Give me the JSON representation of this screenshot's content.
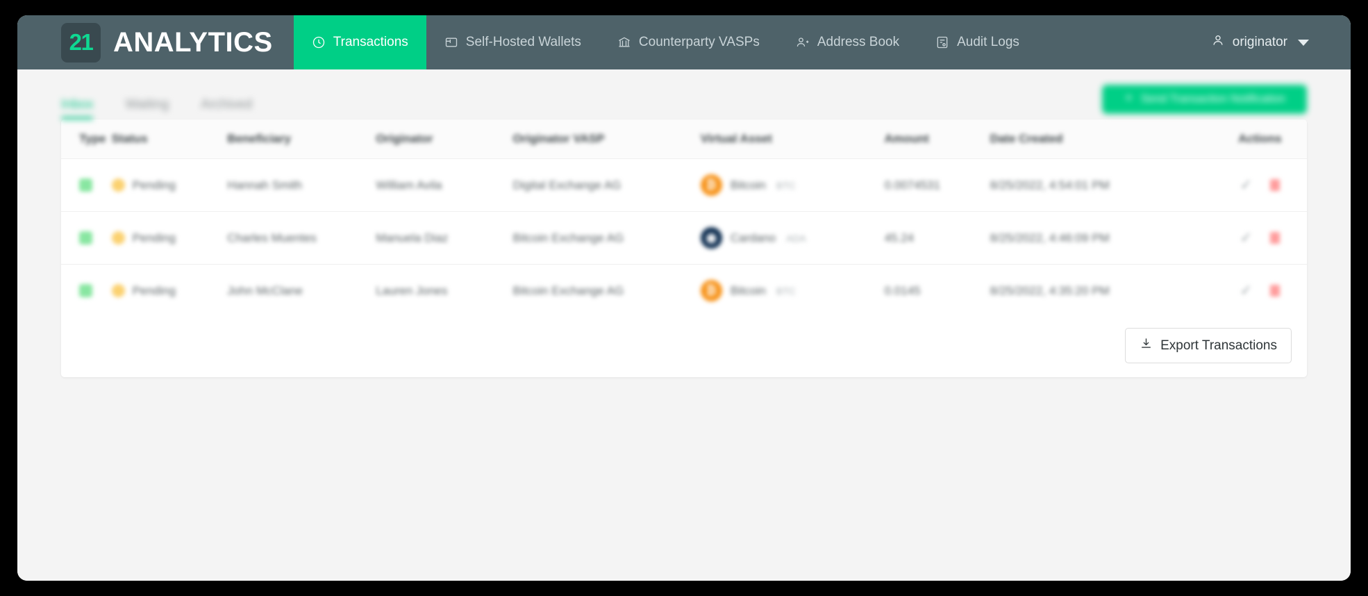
{
  "header": {
    "logo_badge": "21",
    "logo_text": "ANALYTICS",
    "nav": [
      {
        "label": "Transactions",
        "icon": "transactions-icon",
        "active": true
      },
      {
        "label": "Self-Hosted Wallets",
        "icon": "wallet-icon",
        "active": false
      },
      {
        "label": "Counterparty VASPs",
        "icon": "bank-icon",
        "active": false
      },
      {
        "label": "Address Book",
        "icon": "address-book-icon",
        "active": false
      },
      {
        "label": "Audit Logs",
        "icon": "audit-log-icon",
        "active": false
      }
    ],
    "user": {
      "name": "originator",
      "icon": "user-icon",
      "caret": "chevron-down-icon"
    }
  },
  "subtabs": [
    {
      "label": "Inbox",
      "active": true
    },
    {
      "label": "Waiting",
      "active": false
    },
    {
      "label": "Archived",
      "active": false
    }
  ],
  "send_button": {
    "label": "Send Transaction Notification",
    "icon": "plus-icon"
  },
  "table": {
    "columns": [
      "Type",
      "Status",
      "Beneficiary",
      "Originator",
      "Originator VASP",
      "Virtual Asset",
      "Amount",
      "Date Created",
      "Actions"
    ],
    "rows": [
      {
        "type": "outgoing",
        "status": "Pending",
        "beneficiary": "Hannah Smith",
        "originator": "William Avila",
        "originator_vasp": "Digital Exchange AG",
        "asset_name": "Bitcoin",
        "asset_symbol": "BTC",
        "asset_color": "#f7931a",
        "asset_glyph": "₿",
        "amount": "0.0074531",
        "date_created": "8/25/2022, 4:54:01 PM"
      },
      {
        "type": "outgoing",
        "status": "Pending",
        "beneficiary": "Charles Muentes",
        "originator": "Manuela Diaz",
        "originator_vasp": "Bitcoin Exchange AG",
        "asset_name": "Cardano",
        "asset_symbol": "ADA",
        "asset_color": "#0d2d50",
        "asset_glyph": "◉",
        "amount": "45.24",
        "date_created": "8/25/2022, 4:46:09 PM"
      },
      {
        "type": "outgoing",
        "status": "Pending",
        "beneficiary": "John McClane",
        "originator": "Lauren Jones",
        "originator_vasp": "Bitcoin Exchange AG",
        "asset_name": "Bitcoin",
        "asset_symbol": "BTC",
        "asset_color": "#f7931a",
        "asset_glyph": "₿",
        "amount": "0.0145",
        "date_created": "8/25/2022, 4:35:20 PM"
      }
    ],
    "row_actions": {
      "approve": "check-icon",
      "delete": "delete-icon"
    }
  },
  "export_button": {
    "label": "Export Transactions",
    "icon": "download-icon"
  },
  "colors": {
    "header_bg": "#4e6269",
    "accent_green": "#00cf86",
    "logo_green": "#0fd992",
    "page_bg": "#f4f4f4",
    "status_pending": "#fbd170",
    "type_badge": "#88e6a1",
    "delete_red": "#ff9d9d"
  }
}
